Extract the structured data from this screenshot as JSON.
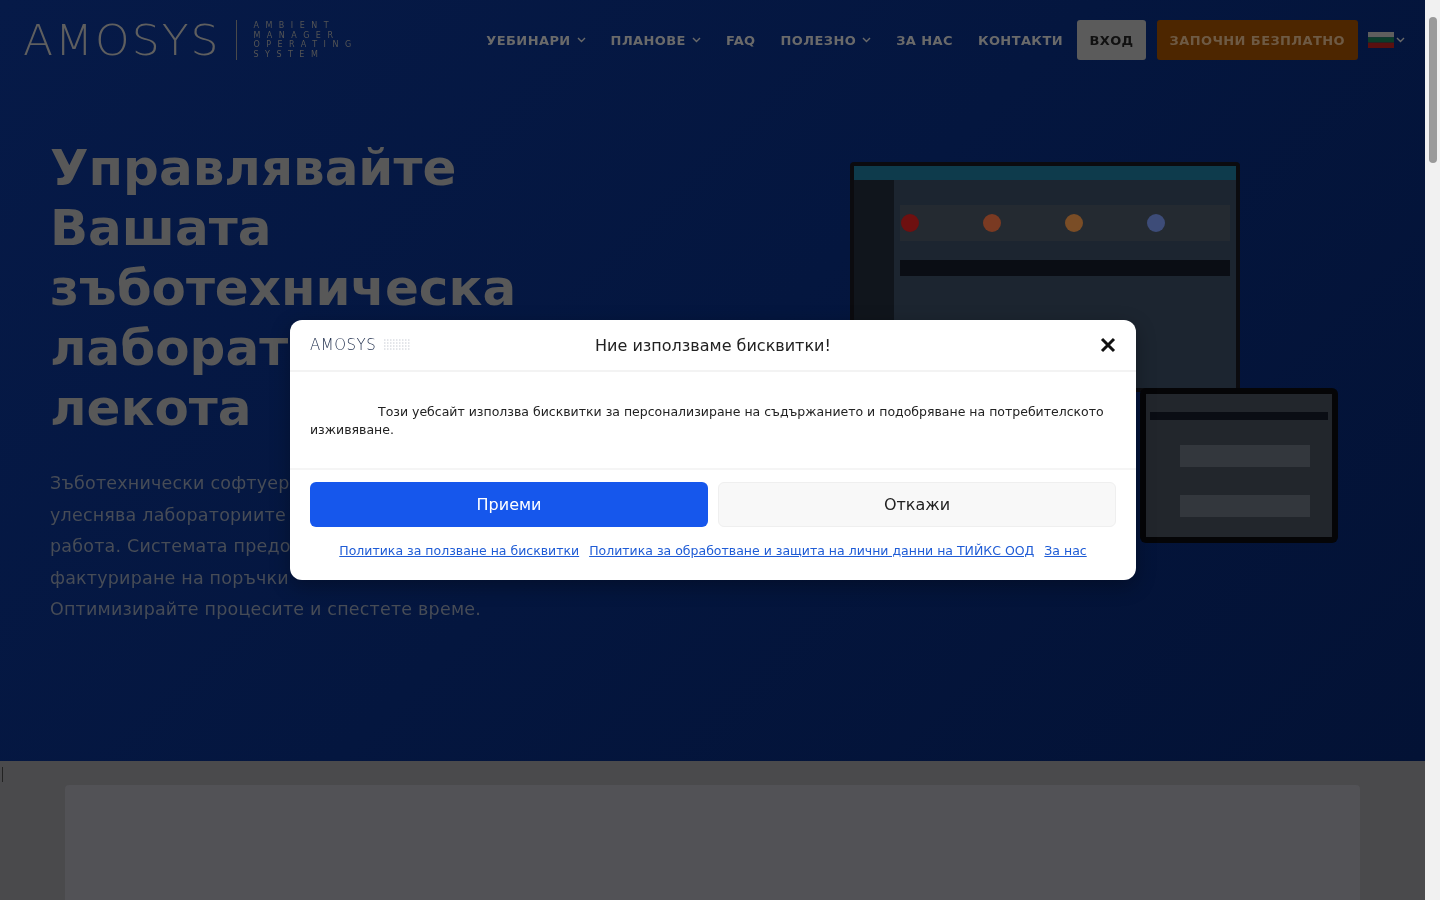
{
  "header": {
    "logo": "AMOSYS",
    "tagline": [
      "AMBIENT",
      "MANAGER",
      "OPERATING",
      "SYSTEM"
    ],
    "nav": [
      {
        "label": "УЕБИНАРИ",
        "dropdown": true
      },
      {
        "label": "ПЛАНОВЕ",
        "dropdown": true
      },
      {
        "label": "FAQ",
        "dropdown": false
      },
      {
        "label": "ПОЛЕЗНО",
        "dropdown": true
      },
      {
        "label": "ЗА НАС",
        "dropdown": false
      },
      {
        "label": "КОНТАКТИ",
        "dropdown": false
      }
    ],
    "login_button": "ВХОД",
    "cta_button": "ЗАПОЧНИ БЕЗПЛАТНО"
  },
  "hero": {
    "heading_lines": [
      "Управлявайте",
      "Вашата",
      "зъботехническа",
      "лаборат",
      "лекота"
    ],
    "paragraph_lines": [
      "Зъботехнически софтуер",
      "улеснява лабораториите",
      "работа. Системата предо",
      "фактуриране на поръчки",
      "Оптимизирайте процесите и спестете време."
    ]
  },
  "cookie_dialog": {
    "logo": "AMOSYS",
    "title": "Ние използваме бисквитки!",
    "message": "Този уебсайт използва бисквитки за персонализиране на съдържанието и подобряване на потребителското изживяване.",
    "accept": "Приеми",
    "reject": "Откажи",
    "links": [
      "Политика за ползване на бисквитки",
      "Политика за обработване и защита на лични данни на ТИЙКС ООД",
      "За нас"
    ]
  }
}
